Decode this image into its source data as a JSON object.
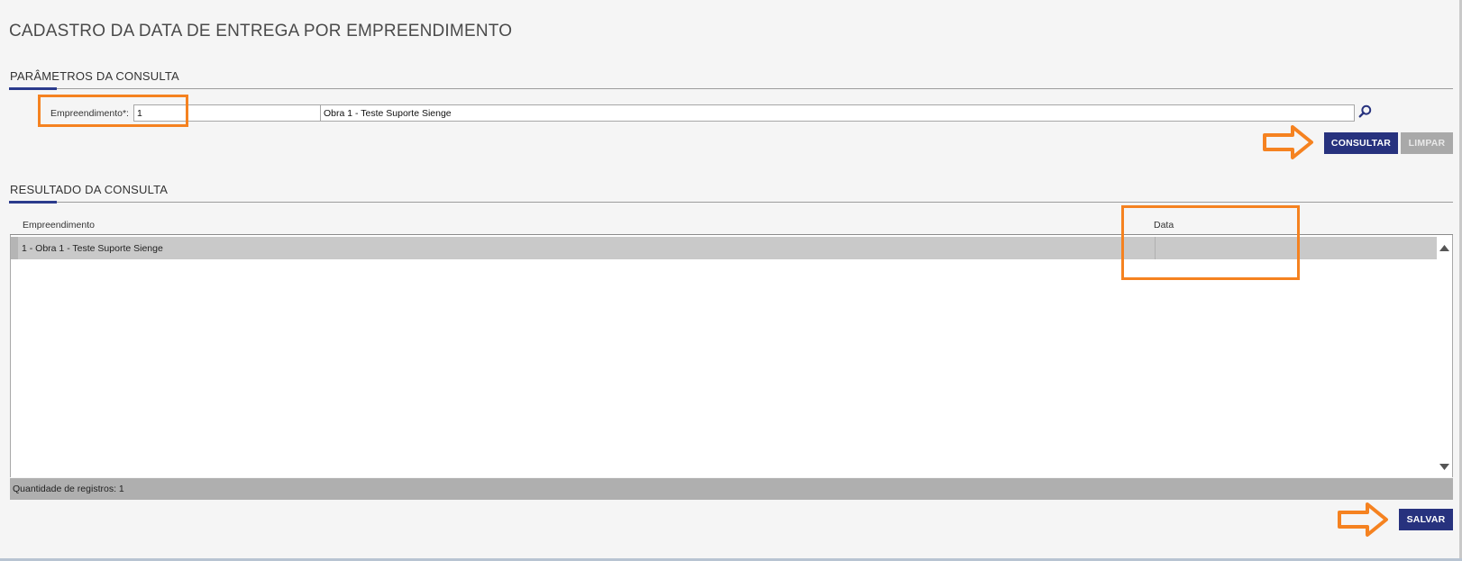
{
  "page": {
    "title": "CADASTRO DA DATA DE ENTREGA POR EMPREENDIMENTO"
  },
  "params": {
    "section_title": "PARÂMETROS DA CONSULTA",
    "empreendimento_label": "Empreendimento*:",
    "empreendimento_code": "1",
    "empreendimento_name": "Obra 1 - Teste Suporte Sienge",
    "consultar_label": "CONSULTAR",
    "limpar_label": "LIMPAR"
  },
  "results": {
    "section_title": "RESULTADO DA CONSULTA",
    "columns": [
      "Empreendimento",
      "Data"
    ],
    "rows": [
      {
        "empreendimento": "1 - Obra 1 - Teste Suporte Sienge",
        "data": ""
      }
    ],
    "count_label": "Quantidade de registros: 1"
  },
  "actions": {
    "salvar_label": "SALVAR"
  },
  "colors": {
    "primary": "#27327e",
    "disabled": "#a9a9a9",
    "annotation": "#f58220",
    "selected_row": "#c9c9c9"
  },
  "icons": {
    "search": "magnifier-icon",
    "scroll_up": "caret-up-icon",
    "scroll_down": "caret-down-icon",
    "annotation_arrow": "arrow-right-icon"
  }
}
